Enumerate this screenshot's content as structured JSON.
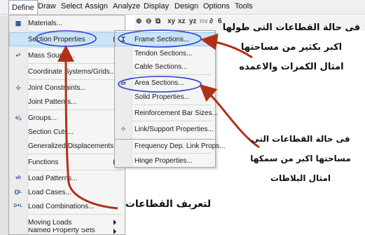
{
  "menubar": {
    "items": [
      "Define",
      "Draw",
      "Select",
      "Assign",
      "Analyze",
      "Display",
      "Design",
      "Options",
      "Tools"
    ]
  },
  "toolbar": {
    "icons": [
      "zoom-in-icon",
      "zoom-out-icon",
      "3d-view-icon",
      "xy",
      "xz",
      "yz",
      "nv",
      "set-display-icon",
      "extra-icon"
    ],
    "labels": {
      "xy": "xy",
      "xz": "xz",
      "yz": "yz",
      "nv": "nv"
    }
  },
  "define_menu": {
    "items": [
      {
        "label": "Materials...",
        "icon": "materials-icon"
      },
      {
        "label": "Section Properties",
        "icon": "",
        "submenu": true
      },
      {
        "label": "Mass Source...",
        "icon": "mass-source-icon"
      },
      {
        "label": "Coordinate Systems/Grids...",
        "icon": ""
      },
      {
        "label": "Joint Constraints...",
        "icon": "joint-constraints-icon"
      },
      {
        "label": "Joint Patterns...",
        "icon": ""
      },
      {
        "label": "Groups...",
        "icon": "groups-icon"
      },
      {
        "label": "Section Cuts...",
        "icon": ""
      },
      {
        "label": "Generalized Displacements...",
        "icon": ""
      },
      {
        "label": "Functions",
        "icon": "",
        "submenu": true
      },
      {
        "label": "Load Patterns...",
        "icon": "load-patterns-icon"
      },
      {
        "label": "Load Cases...",
        "icon": "load-cases-icon"
      },
      {
        "label": "Load Combinations...",
        "icon": "load-combinations-icon"
      },
      {
        "label": "Moving Loads",
        "icon": "",
        "submenu": true
      },
      {
        "label": "Named Property Sets",
        "icon": "",
        "submenu": true
      }
    ],
    "icon_glyphs": {
      "mass": "•²",
      "joint": "⊹",
      "groups": "⁴⁄₀",
      "lp": "ᵛᴰ",
      "lc": "Dᴸ",
      "lcomb": "ᴰ⁺ᴸ"
    }
  },
  "section_submenu": {
    "items": [
      {
        "label": "Frame Sections...",
        "icon": "frame-section-icon"
      },
      {
        "label": "Tendon Sections...",
        "icon": ""
      },
      {
        "label": "Cable Sections...",
        "icon": ""
      },
      {
        "label": "Area Sections...",
        "icon": "area-section-icon"
      },
      {
        "label": "Solid Properties...",
        "icon": ""
      },
      {
        "label": "Reinforcement Bar Sizes...",
        "icon": ""
      },
      {
        "label": "Link/Support Properties...",
        "icon": "link-support-icon"
      },
      {
        "label": "Frequency Dep. Link Props...",
        "icon": ""
      },
      {
        "label": "Hinge Properties...",
        "icon": ""
      }
    ]
  },
  "annotations": {
    "frame_note": [
      "فى حالة القطاعات التى طولها",
      "اكبر بكثير من مساحتها",
      "امثال الكمرات والاعمده"
    ],
    "area_note": [
      "فى حالة القطاعات التى",
      "مساحتها اكبر من سمكها",
      "امثال البلاطات"
    ],
    "define_note": "لتعريف القطاعات"
  },
  "colors": {
    "highlight_oval": "#2c3fd0",
    "arrow": "#b03018",
    "menu_highlight": "#cce4f7"
  }
}
